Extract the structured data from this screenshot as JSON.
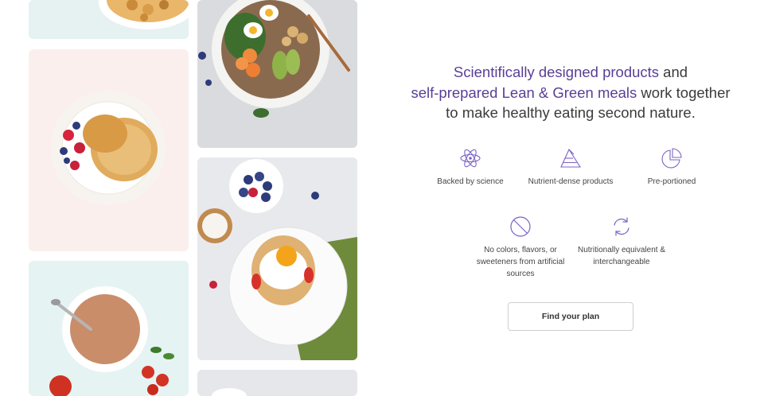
{
  "headline": {
    "part1_accent": "Scientifically designed products",
    "part1_rest": " and",
    "part2_accent": "self-prepared Lean & Green meals",
    "part2_rest": " work together",
    "part3": "to make healthy eating second nature."
  },
  "features": [
    {
      "icon": "atom-icon",
      "label": "Backed by science"
    },
    {
      "icon": "pyramid-icon",
      "label": "Nutrient-dense products"
    },
    {
      "icon": "pie-chart-icon",
      "label": "Pre-portioned"
    },
    {
      "icon": "no-sign-icon",
      "label": "No colors, flavors, or sweeteners from artificial sources"
    },
    {
      "icon": "refresh-icon",
      "label": "Nutritionally equivalent & interchangeable"
    }
  ],
  "cta": {
    "label": "Find your plan"
  },
  "colors": {
    "accent": "#5a3e96",
    "icon": "#7b63c6",
    "text": "#3b3b3b"
  }
}
